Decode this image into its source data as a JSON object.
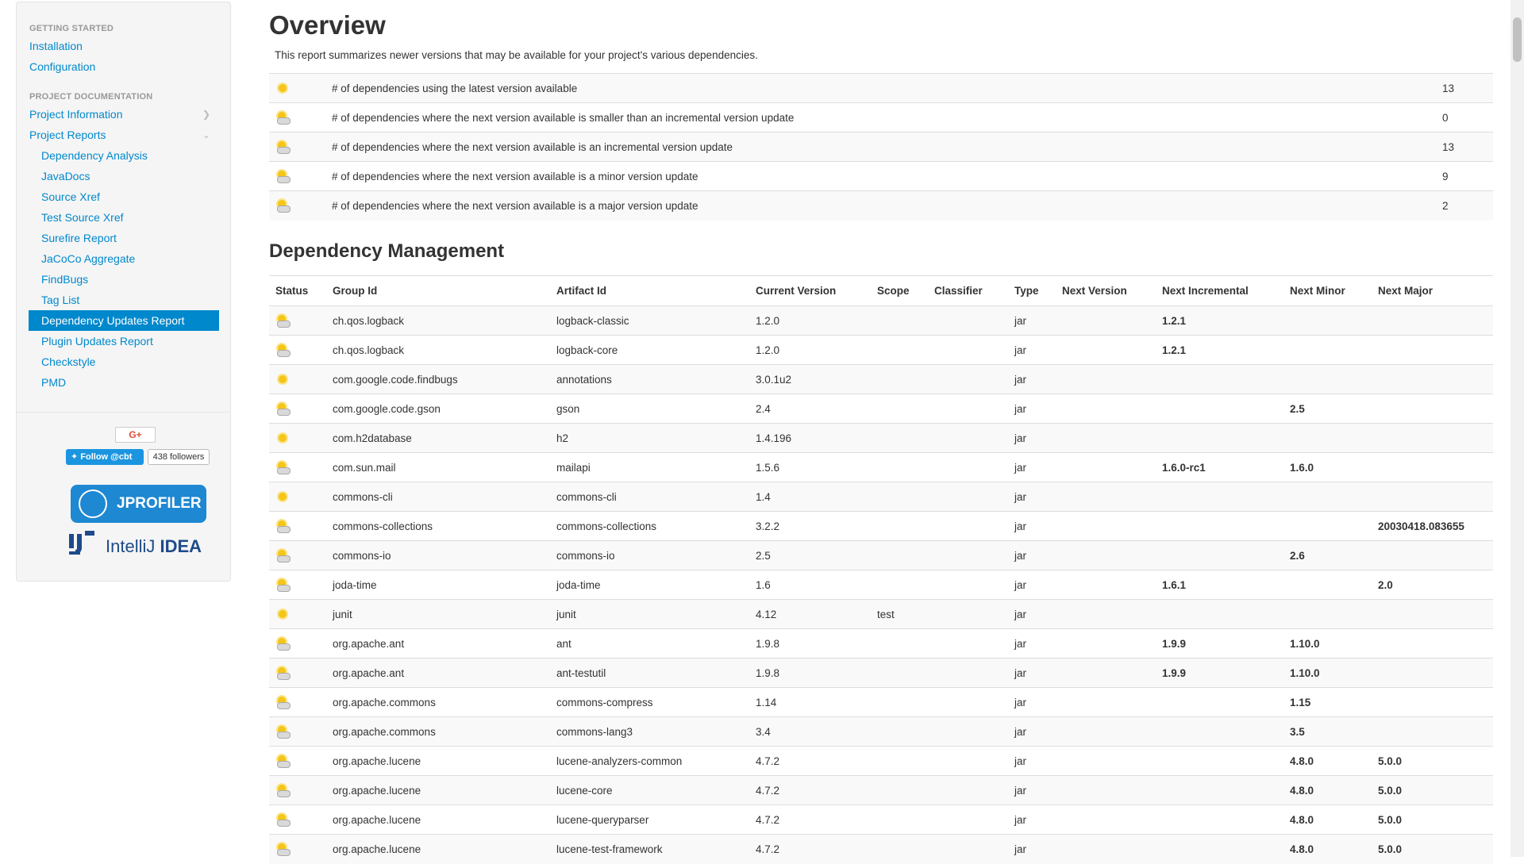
{
  "sidebar": {
    "getting_started_header": "GETTING STARTED",
    "getting_started_items": [
      "Installation",
      "Configuration"
    ],
    "project_docs_header": "PROJECT DOCUMENTATION",
    "project_information": "Project Information",
    "project_reports": "Project Reports",
    "report_items": [
      "Dependency Analysis",
      "JavaDocs",
      "Source Xref",
      "Test Source Xref",
      "Surefire Report",
      "JaCoCo Aggregate",
      "FindBugs",
      "Tag List",
      "Dependency Updates Report",
      "Plugin Updates Report",
      "Checkstyle",
      "PMD"
    ],
    "active_item": "Dependency Updates Report",
    "colors": {
      "link": "#0088cc",
      "active_bg": "#0088cc"
    }
  },
  "social": {
    "gplus_label": "G+",
    "twitter_label": "Follow @cbt",
    "twitter_followers": "438 followers",
    "jprofiler_label": "JPROFILER",
    "idea_label_light": "IntelliJ ",
    "idea_label_bold": "IDEA"
  },
  "overview": {
    "title": "Overview",
    "description": "This report summarizes newer versions that may be available for your project's various dependencies.",
    "rows": [
      {
        "icon": "sun-icon",
        "label": "# of dependencies using the latest version available",
        "count": "13"
      },
      {
        "icon": "cloud-sun-icon",
        "label": "# of dependencies where the next version available is smaller than an incremental version update",
        "count": "0"
      },
      {
        "icon": "cloud-sun-icon",
        "label": "# of dependencies where the next version available is an incremental version update",
        "count": "13"
      },
      {
        "icon": "cloud-sun-icon",
        "label": "# of dependencies where the next version available is a minor version update",
        "count": "9"
      },
      {
        "icon": "cloud-sun-icon",
        "label": "# of dependencies where the next version available is a major version update",
        "count": "2"
      }
    ]
  },
  "dependency_management": {
    "title": "Dependency Management",
    "columns": [
      "Status",
      "Group Id",
      "Artifact Id",
      "Current Version",
      "Scope",
      "Classifier",
      "Type",
      "Next Version",
      "Next Incremental",
      "Next Minor",
      "Next Major"
    ],
    "rows": [
      {
        "icon": "cloud-sun-icon",
        "group": "ch.qos.logback",
        "artifact": "logback-classic",
        "current": "1.2.0",
        "scope": "",
        "classifier": "",
        "type": "jar",
        "next": "",
        "incremental": "1.2.1",
        "minor": "",
        "major": ""
      },
      {
        "icon": "cloud-sun-icon",
        "group": "ch.qos.logback",
        "artifact": "logback-core",
        "current": "1.2.0",
        "scope": "",
        "classifier": "",
        "type": "jar",
        "next": "",
        "incremental": "1.2.1",
        "minor": "",
        "major": ""
      },
      {
        "icon": "sun-icon",
        "group": "com.google.code.findbugs",
        "artifact": "annotations",
        "current": "3.0.1u2",
        "scope": "",
        "classifier": "",
        "type": "jar",
        "next": "",
        "incremental": "",
        "minor": "",
        "major": ""
      },
      {
        "icon": "cloud-sun-icon",
        "group": "com.google.code.gson",
        "artifact": "gson",
        "current": "2.4",
        "scope": "",
        "classifier": "",
        "type": "jar",
        "next": "",
        "incremental": "",
        "minor": "2.5",
        "major": ""
      },
      {
        "icon": "sun-icon",
        "group": "com.h2database",
        "artifact": "h2",
        "current": "1.4.196",
        "scope": "",
        "classifier": "",
        "type": "jar",
        "next": "",
        "incremental": "",
        "minor": "",
        "major": ""
      },
      {
        "icon": "cloud-sun-icon",
        "group": "com.sun.mail",
        "artifact": "mailapi",
        "current": "1.5.6",
        "scope": "",
        "classifier": "",
        "type": "jar",
        "next": "",
        "incremental": "1.6.0-rc1",
        "minor": "1.6.0",
        "major": ""
      },
      {
        "icon": "sun-icon",
        "group": "commons-cli",
        "artifact": "commons-cli",
        "current": "1.4",
        "scope": "",
        "classifier": "",
        "type": "jar",
        "next": "",
        "incremental": "",
        "minor": "",
        "major": ""
      },
      {
        "icon": "cloud-sun-icon",
        "group": "commons-collections",
        "artifact": "commons-collections",
        "current": "3.2.2",
        "scope": "",
        "classifier": "",
        "type": "jar",
        "next": "",
        "incremental": "",
        "minor": "",
        "major": "20030418.083655"
      },
      {
        "icon": "cloud-sun-icon",
        "group": "commons-io",
        "artifact": "commons-io",
        "current": "2.5",
        "scope": "",
        "classifier": "",
        "type": "jar",
        "next": "",
        "incremental": "",
        "minor": "2.6",
        "major": ""
      },
      {
        "icon": "cloud-sun-icon",
        "group": "joda-time",
        "artifact": "joda-time",
        "current": "1.6",
        "scope": "",
        "classifier": "",
        "type": "jar",
        "next": "",
        "incremental": "1.6.1",
        "minor": "",
        "major": "2.0"
      },
      {
        "icon": "sun-icon",
        "group": "junit",
        "artifact": "junit",
        "current": "4.12",
        "scope": "test",
        "classifier": "",
        "type": "jar",
        "next": "",
        "incremental": "",
        "minor": "",
        "major": ""
      },
      {
        "icon": "cloud-sun-icon",
        "group": "org.apache.ant",
        "artifact": "ant",
        "current": "1.9.8",
        "scope": "",
        "classifier": "",
        "type": "jar",
        "next": "",
        "incremental": "1.9.9",
        "minor": "1.10.0",
        "major": ""
      },
      {
        "icon": "cloud-sun-icon",
        "group": "org.apache.ant",
        "artifact": "ant-testutil",
        "current": "1.9.8",
        "scope": "",
        "classifier": "",
        "type": "jar",
        "next": "",
        "incremental": "1.9.9",
        "minor": "1.10.0",
        "major": ""
      },
      {
        "icon": "cloud-sun-icon",
        "group": "org.apache.commons",
        "artifact": "commons-compress",
        "current": "1.14",
        "scope": "",
        "classifier": "",
        "type": "jar",
        "next": "",
        "incremental": "",
        "minor": "1.15",
        "major": ""
      },
      {
        "icon": "cloud-sun-icon",
        "group": "org.apache.commons",
        "artifact": "commons-lang3",
        "current": "3.4",
        "scope": "",
        "classifier": "",
        "type": "jar",
        "next": "",
        "incremental": "",
        "minor": "3.5",
        "major": ""
      },
      {
        "icon": "cloud-sun-icon",
        "group": "org.apache.lucene",
        "artifact": "lucene-analyzers-common",
        "current": "4.7.2",
        "scope": "",
        "classifier": "",
        "type": "jar",
        "next": "",
        "incremental": "",
        "minor": "4.8.0",
        "major": "5.0.0"
      },
      {
        "icon": "cloud-sun-icon",
        "group": "org.apache.lucene",
        "artifact": "lucene-core",
        "current": "4.7.2",
        "scope": "",
        "classifier": "",
        "type": "jar",
        "next": "",
        "incremental": "",
        "minor": "4.8.0",
        "major": "5.0.0"
      },
      {
        "icon": "cloud-sun-icon",
        "group": "org.apache.lucene",
        "artifact": "lucene-queryparser",
        "current": "4.7.2",
        "scope": "",
        "classifier": "",
        "type": "jar",
        "next": "",
        "incremental": "",
        "minor": "4.8.0",
        "major": "5.0.0"
      },
      {
        "icon": "cloud-sun-icon",
        "group": "org.apache.lucene",
        "artifact": "lucene-test-framework",
        "current": "4.7.2",
        "scope": "",
        "classifier": "",
        "type": "jar",
        "next": "",
        "incremental": "",
        "minor": "4.8.0",
        "major": "5.0.0"
      }
    ]
  }
}
